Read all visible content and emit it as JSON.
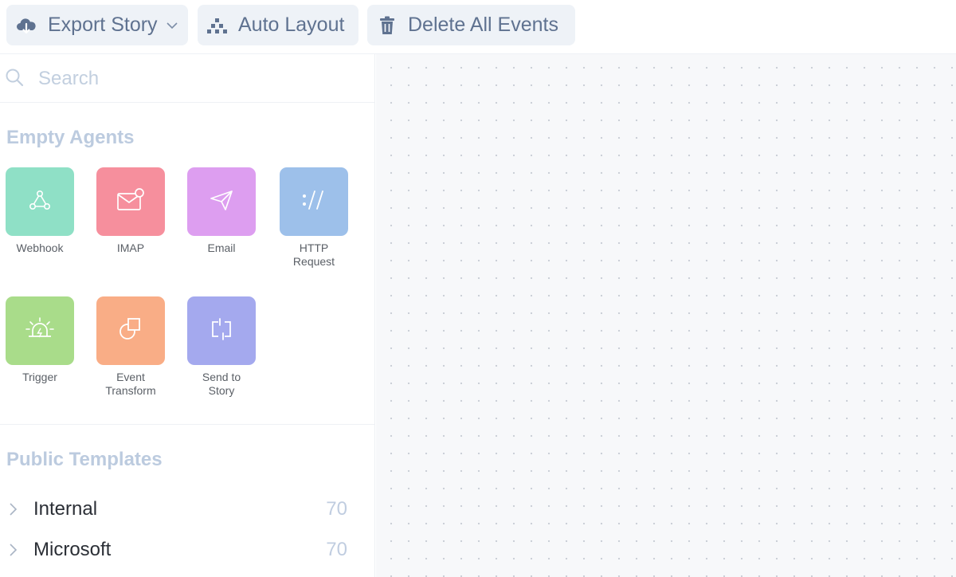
{
  "toolbar": {
    "export_label": "Export Story",
    "export_icon": "cloud-download-icon",
    "layout_label": "Auto Layout",
    "layout_icon": "hierarchy-icon",
    "delete_label": "Delete All Events",
    "delete_icon": "trash-icon"
  },
  "search": {
    "placeholder": "Search",
    "value": ""
  },
  "empty_agents": {
    "title": "Empty Agents",
    "items": [
      {
        "label": "Webhook",
        "icon": "webhook-icon",
        "color": "#8fe0c6"
      },
      {
        "label": "IMAP",
        "icon": "mail-notification-icon",
        "color": "#f68f9d"
      },
      {
        "label": "Email",
        "icon": "paper-plane-icon",
        "color": "#dd9ef0"
      },
      {
        "label": "HTTP Request",
        "icon": "url-slashes-icon",
        "color": "#9dc0ea"
      },
      {
        "label": "Trigger",
        "icon": "siren-icon",
        "color": "#a9dc8a"
      },
      {
        "label": "Event Transform",
        "icon": "shapes-icon",
        "color": "#f9ad86"
      },
      {
        "label": "Send to Story",
        "icon": "loop-arrows-icon",
        "color": "#a4a9ee"
      }
    ]
  },
  "public_templates": {
    "title": "Public Templates",
    "rows": [
      {
        "name": "Internal",
        "count": "70"
      },
      {
        "name": "Microsoft",
        "count": "70"
      }
    ]
  },
  "colors": {
    "toolbar_button_bg": "#eef2f7",
    "toolbar_text": "#5f7290",
    "section_title": "#bccbdf",
    "canvas_bg": "#f7f8fa"
  }
}
